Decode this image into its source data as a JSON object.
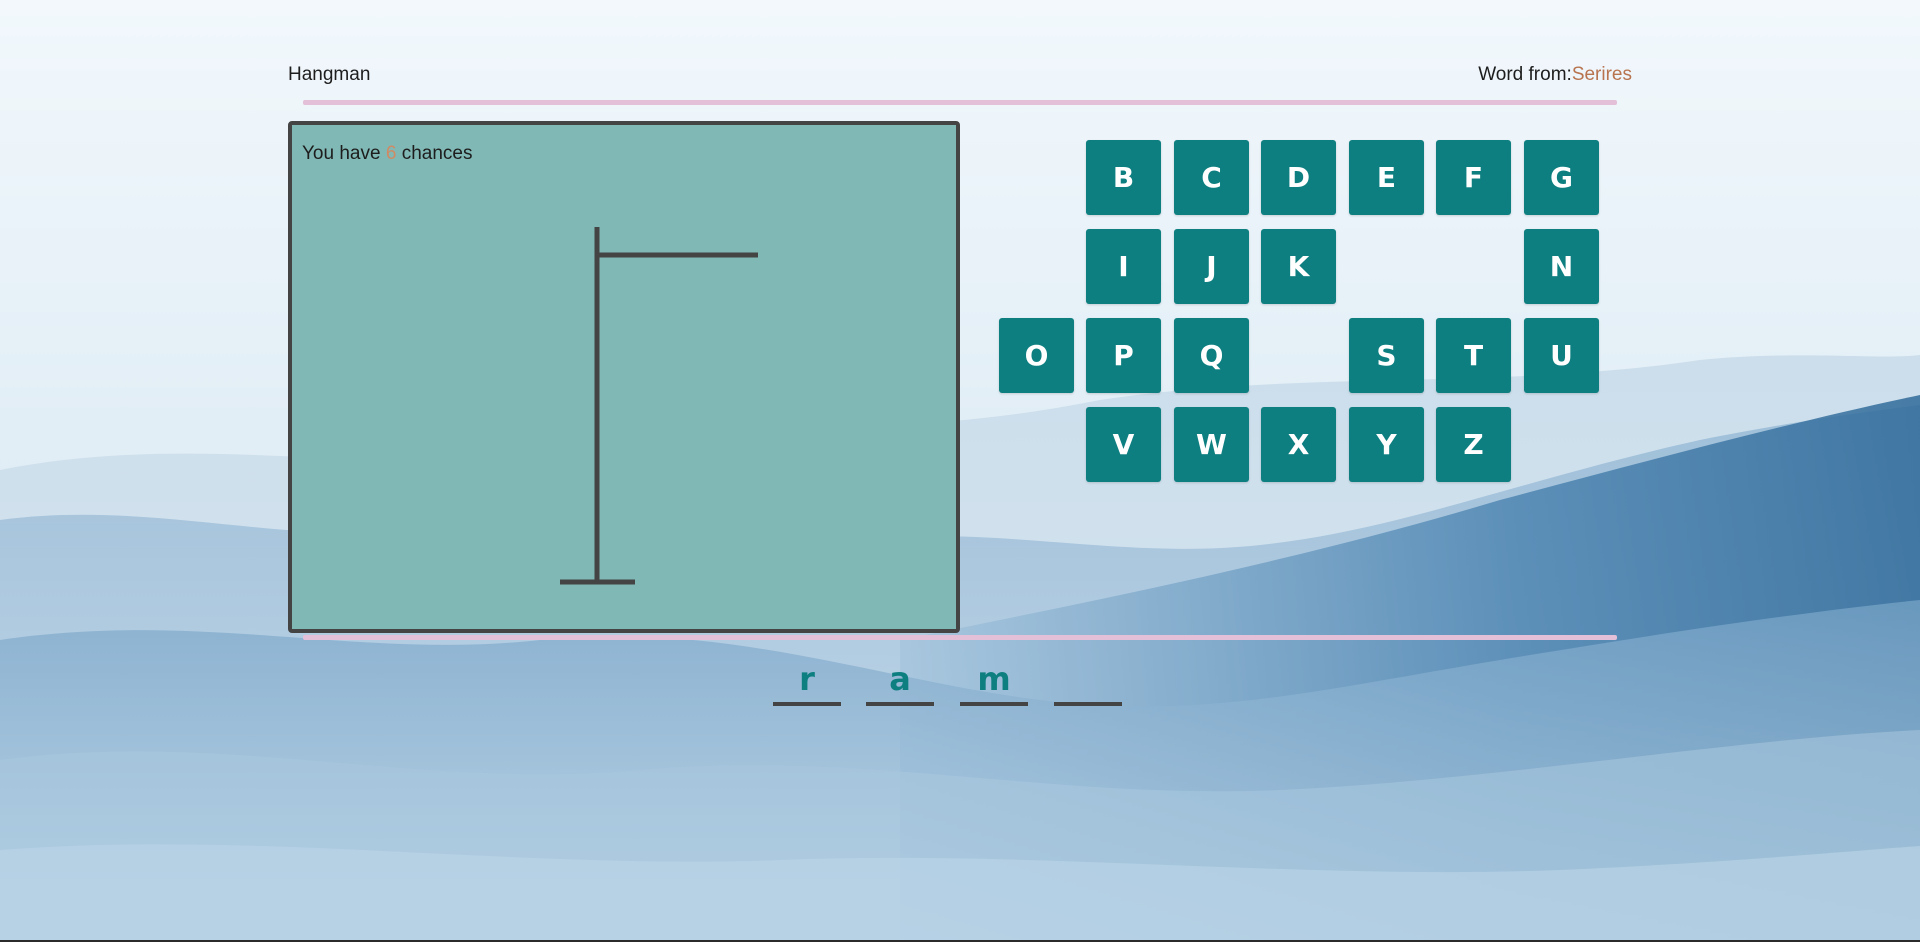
{
  "header": {
    "title": "Hangman",
    "word_from_label": "Word from:",
    "category": "Serires"
  },
  "game": {
    "chances_prefix": "You have",
    "chances_count": "6",
    "chances_suffix": "chances"
  },
  "keyboard": {
    "row1": [
      "B",
      "C",
      "D",
      "E",
      "F",
      "G"
    ],
    "row2": [
      "I",
      "J",
      "K",
      "N"
    ],
    "row3": [
      "O",
      "P",
      "Q",
      "S",
      "T",
      "U"
    ],
    "row4": [
      "V",
      "W",
      "X",
      "Y",
      "Z"
    ]
  },
  "word": {
    "slots": [
      "r",
      "a",
      "m",
      ""
    ]
  },
  "colors": {
    "key_bg": "#0e7f80",
    "panel_bg": "#80b8b5",
    "accent_category": "#b8734f",
    "rule": "#e4bfd8"
  }
}
